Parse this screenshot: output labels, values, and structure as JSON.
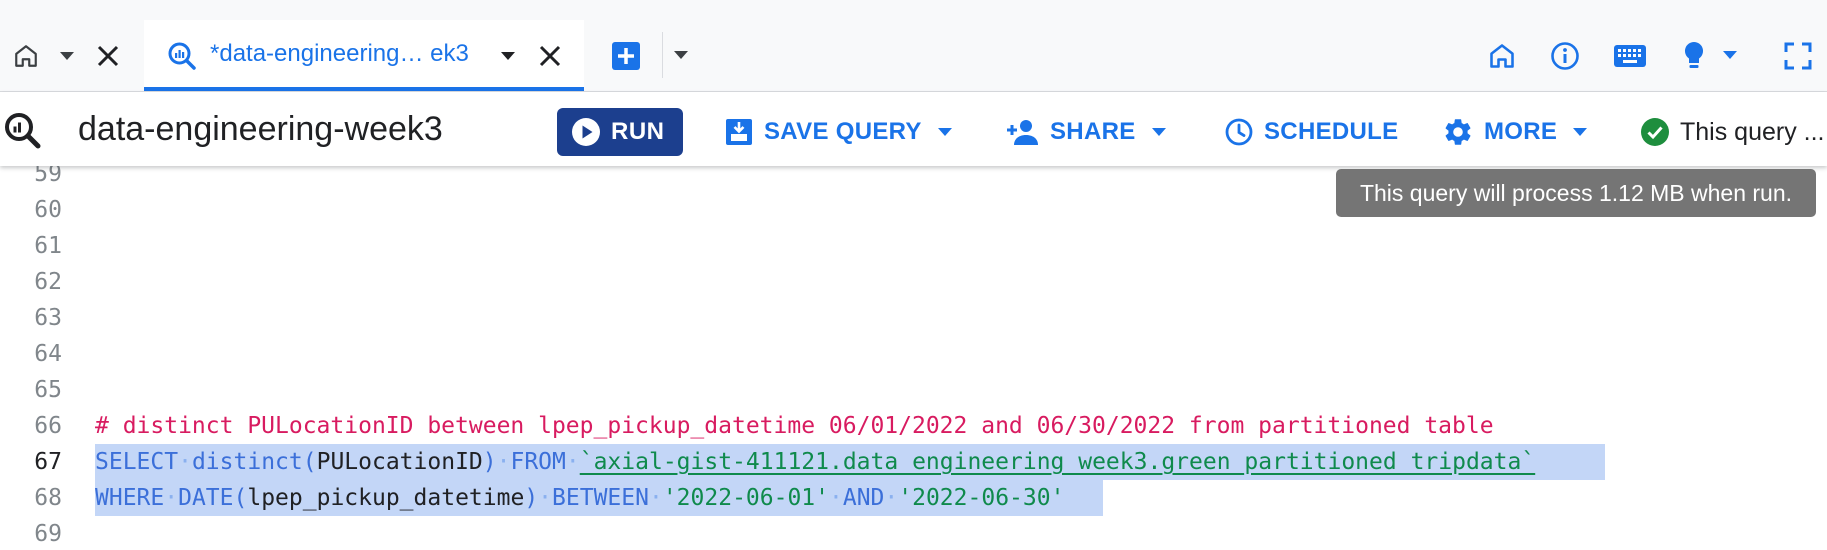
{
  "tabbar": {
    "home_tab_icon": "home-icon",
    "active_tab": {
      "title": "*data-engineering… ek3",
      "icon": "bigquery-query-icon"
    },
    "new_tab_icon": "add-box-icon",
    "right_icons": [
      "home-icon",
      "info-icon",
      "keyboard-icon",
      "lightbulb-icon",
      "fullscreen-icon"
    ]
  },
  "toolbar": {
    "query_name": "data-engineering-week3",
    "run_label": "RUN",
    "save_query_label": "SAVE QUERY",
    "share_label": "SHARE",
    "schedule_label": "SCHEDULE",
    "more_label": "MORE",
    "status_text": "This query ..."
  },
  "tooltip": {
    "text": "This query will process 1.12 MB when run."
  },
  "editor": {
    "line_numbers": [
      "59",
      "60",
      "61",
      "62",
      "63",
      "64",
      "65",
      "66",
      "67",
      "68",
      "69"
    ],
    "current_line": "67",
    "comment_line": "# distinct PULocationID between lpep_pickup_datetime 06/01/2022 and 06/30/2022 from partitioned table",
    "line67": {
      "select": "SELECT",
      "distinct": "distinct",
      "open_paren": "(",
      "column": "PULocationID",
      "close_paren": ")",
      "from": "FROM",
      "table": "`axial-gist-411121.data_engineering_week3.green_partitioned_tripdata`"
    },
    "line68": {
      "where": "WHERE",
      "date_fn": "DATE",
      "open_paren": "(",
      "column": "lpep_pickup_datetime",
      "close_paren": ")",
      "between": "BETWEEN",
      "start": "'2022-06-01'",
      "and": "AND",
      "end": "'2022-06-30'"
    }
  },
  "colors": {
    "accent": "#1a73e8",
    "run_button": "#1c3f8e",
    "keyword": "#3b6fd9",
    "string": "#0f8a4c",
    "comment": "#d81b60",
    "selection": "#c3d6f7",
    "status_ok": "#1e8e3e"
  }
}
